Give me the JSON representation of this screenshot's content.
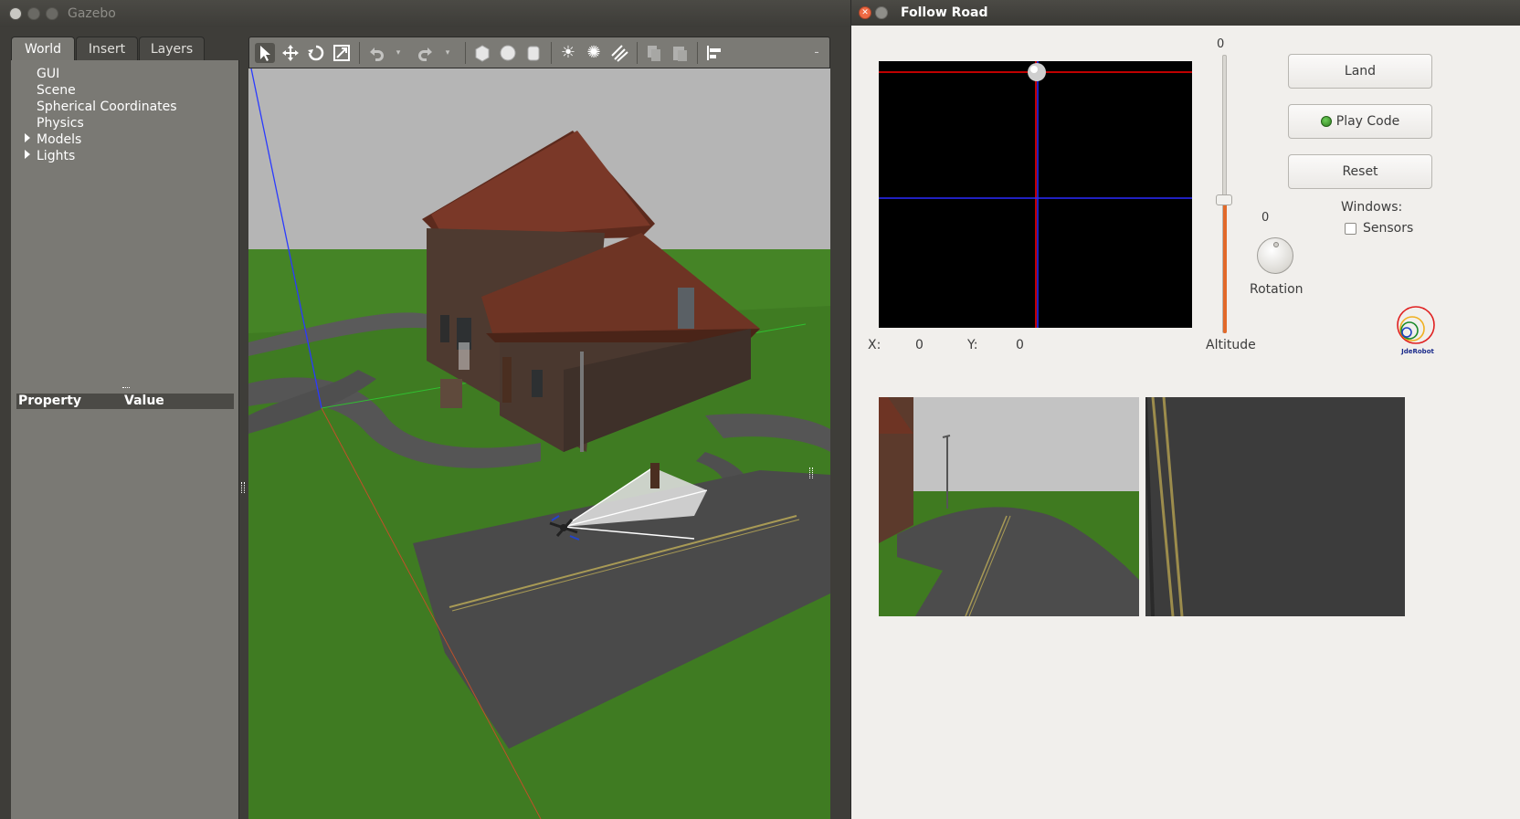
{
  "gazebo": {
    "title": "Gazebo",
    "tabs": [
      "World",
      "Insert",
      "Layers"
    ],
    "tree": [
      "GUI",
      "Scene",
      "Spherical Coordinates",
      "Physics",
      "Models",
      "Lights"
    ],
    "property_header": {
      "property": "Property",
      "value": "Value"
    },
    "toolbar_icons": [
      "select-icon",
      "translate-icon",
      "rotate-icon",
      "scale-icon",
      "undo-icon",
      "redo-icon",
      "box-icon",
      "sphere-icon",
      "cylinder-icon",
      "point-light-icon",
      "spot-light-icon",
      "directional-light-icon",
      "copy-icon",
      "paste-icon",
      "align-icon"
    ]
  },
  "follow_road": {
    "title": "Follow Road",
    "coords": {
      "x_label": "X:",
      "x_value": "0",
      "y_label": "Y:",
      "y_value": "0"
    },
    "altitude": {
      "value": "0",
      "label": "Altitude",
      "level": 0.48
    },
    "rotation": {
      "value": "0",
      "label": "Rotation"
    },
    "buttons": {
      "land": "Land",
      "play": "Play Code",
      "reset": "Reset"
    },
    "windows": {
      "label": "Windows:",
      "sensors": "Sensors",
      "sensors_checked": false
    },
    "logo_text": "JdeRobot"
  },
  "colors": {
    "grass": "#3e7a1f",
    "road": "#4a4a4a",
    "accent_orange": "#e2692a",
    "cross_red": "#ff0000",
    "cross_blue": "#0000ff"
  }
}
